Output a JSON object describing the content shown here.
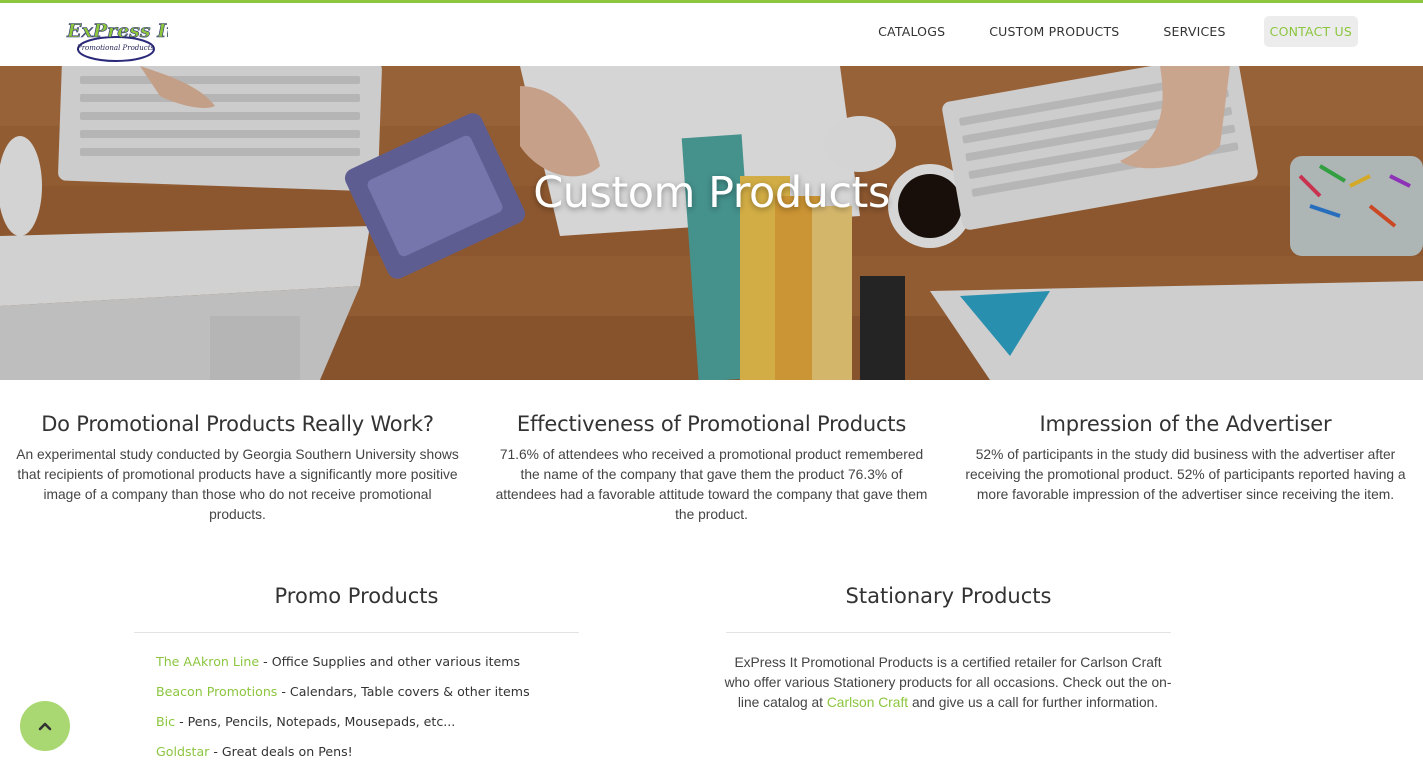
{
  "brand": {
    "logo_text": "ExPress It!",
    "logo_tagline": "Promotional Products",
    "accent_color": "#8cc63f"
  },
  "nav": {
    "items": [
      {
        "label": "CATALOGS"
      },
      {
        "label": "CUSTOM PRODUCTS"
      },
      {
        "label": "SERVICES"
      },
      {
        "label": "CONTACT US"
      }
    ]
  },
  "hero": {
    "title": "Custom Products"
  },
  "info": [
    {
      "heading": "Do Promotional Products Really Work?",
      "body": "An experimental study conducted by Georgia Southern University shows that recipients of promotional products have a significantly more positive image of a company than those who do not receive promotional products."
    },
    {
      "heading": "Effectiveness of Promotional Products",
      "body": "71.6% of attendees who received a promotional product remembered the name of the company that gave them the product 76.3% of attendees had a favorable attitude toward the company that gave them the product."
    },
    {
      "heading": "Impression of the Advertiser",
      "body": "52% of participants in the study did business with the advertiser after receiving the promotional product. 52% of participants reported having a more favorable impression of the advertiser since receiving the item."
    }
  ],
  "promo": {
    "title": "Promo Products",
    "items": [
      {
        "link": "The AAkron Line",
        "desc": " - Office Supplies and other various items"
      },
      {
        "link": "Beacon Promotions",
        "desc": " - Calendars, Table covers & other items"
      },
      {
        "link": "Bic",
        "desc": " - Pens, Pencils, Notepads, Mousepads, etc..."
      },
      {
        "link": "Goldstar",
        "desc": " - Great deals on Pens!"
      }
    ]
  },
  "stationary": {
    "title": "Stationary Products",
    "text_before": "ExPress It Promotional Products is a certified retailer for Carlson Craft who offer various Stationery products for all occasions. Check out the on-line catalog at ",
    "link": "Carlson Craft",
    "text_after": " and give us a call for further information."
  },
  "back_to_top": {
    "icon": "chevron-up-icon"
  }
}
